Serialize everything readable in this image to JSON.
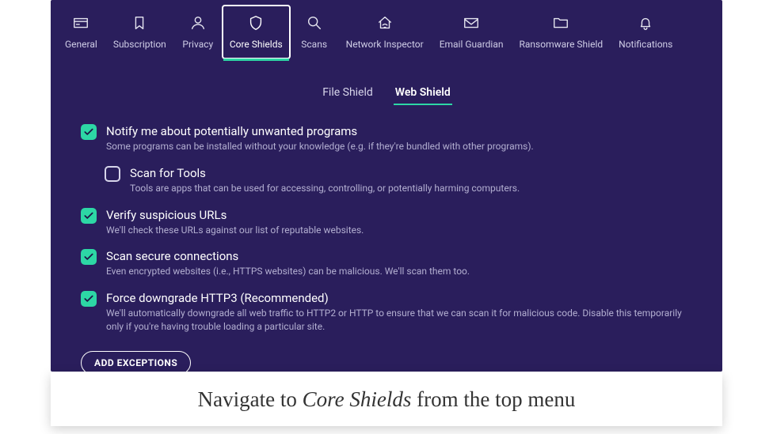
{
  "nav": [
    {
      "id": "general",
      "label": "General",
      "icon": "card"
    },
    {
      "id": "subscription",
      "label": "Subscription",
      "icon": "bookmark"
    },
    {
      "id": "privacy",
      "label": "Privacy",
      "icon": "user"
    },
    {
      "id": "core-shields",
      "label": "Core Shields",
      "icon": "shield",
      "selected": true
    },
    {
      "id": "scans",
      "label": "Scans",
      "icon": "magnify"
    },
    {
      "id": "network",
      "label": "Network Inspector",
      "icon": "home-wifi"
    },
    {
      "id": "email",
      "label": "Email Guardian",
      "icon": "envelope"
    },
    {
      "id": "ransomware",
      "label": "Ransomware Shield",
      "icon": "folder"
    },
    {
      "id": "notifications",
      "label": "Notifications",
      "icon": "bell"
    }
  ],
  "subtabs": [
    {
      "id": "file-shield",
      "label": "File Shield"
    },
    {
      "id": "web-shield",
      "label": "Web Shield",
      "selected": true
    }
  ],
  "settings": [
    {
      "id": "notify-pup",
      "checked": true,
      "title": "Notify me about potentially unwanted programs",
      "desc": "Some programs can be installed without your knowledge (e.g. if they're bundled with other programs)."
    },
    {
      "id": "scan-tools",
      "checked": false,
      "nested": true,
      "title": "Scan for Tools",
      "desc": "Tools are apps that can be used for accessing, controlling, or potentially harming computers."
    },
    {
      "id": "verify-urls",
      "checked": true,
      "title": "Verify suspicious URLs",
      "desc": "We'll check these URLs against our list of reputable websites."
    },
    {
      "id": "scan-secure",
      "checked": true,
      "title": "Scan secure connections",
      "desc": "Even encrypted websites (i.e., HTTPS websites) can be malicious. We'll scan them too."
    },
    {
      "id": "force-downgrade",
      "checked": true,
      "title": "Force downgrade HTTP3 (Recommended)",
      "desc": "We'll automatically downgrade all web traffic to HTTP2 or HTTP to ensure that we can scan it for malicious code. Disable this temporarily only if you're having trouble loading a particular site."
    }
  ],
  "add_exceptions_label": "ADD EXCEPTIONS",
  "caption_prefix": "Navigate to ",
  "caption_emph": "Core Shields",
  "caption_suffix": " from the top menu"
}
